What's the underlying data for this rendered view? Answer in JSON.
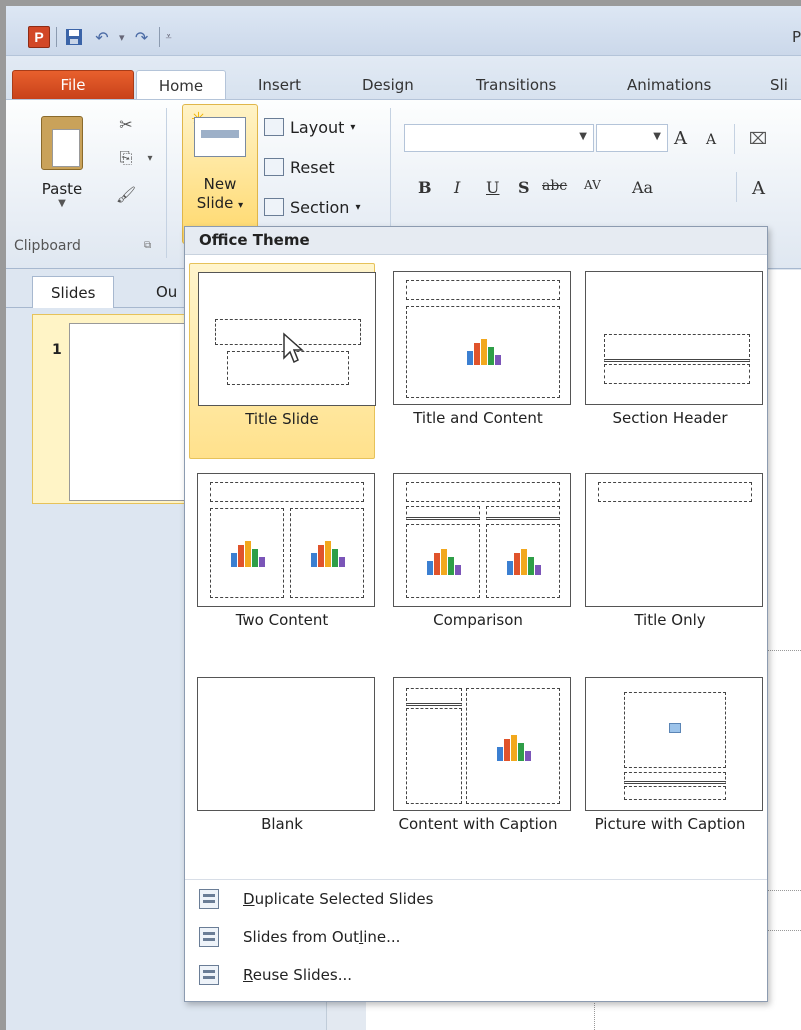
{
  "titlebar": {
    "app_icon": "P",
    "title_fragment": "P",
    "qat_icons": [
      "save-icon",
      "undo-icon",
      "redo-icon",
      "customize-qat-icon"
    ]
  },
  "tabs": [
    "File",
    "Home",
    "Insert",
    "Design",
    "Transitions",
    "Animations",
    "Sli"
  ],
  "ribbon": {
    "paste_label": "Paste",
    "clipboard_label": "Clipboard",
    "new_slide_label_1": "New",
    "new_slide_label_2": "Slide",
    "layout_label": "Layout",
    "reset_label": "Reset",
    "section_label": "Section",
    "format_buttons": [
      "B",
      "I",
      "U",
      "S",
      "abc",
      "AV",
      "Aa",
      "A"
    ],
    "grow_font": "A",
    "shrink_font": "A"
  },
  "pane": {
    "tabs": [
      "Slides",
      "Ou"
    ],
    "slide_number": "1"
  },
  "gallery": {
    "header": "Office Theme",
    "layouts": [
      {
        "name": "Title Slide",
        "selected": true
      },
      {
        "name": "Title and Content"
      },
      {
        "name": "Section Header"
      },
      {
        "name": "Two Content"
      },
      {
        "name": "Comparison"
      },
      {
        "name": "Title Only"
      },
      {
        "name": "Blank"
      },
      {
        "name": "Content with Caption"
      },
      {
        "name": "Picture with Caption"
      }
    ],
    "menu": [
      {
        "pre": "",
        "u": "D",
        "post": "uplicate Selected Slides"
      },
      {
        "pre": "Slides from Out",
        "u": "l",
        "post": "ine..."
      },
      {
        "pre": "",
        "u": "R",
        "post": "euse Slides..."
      }
    ]
  }
}
